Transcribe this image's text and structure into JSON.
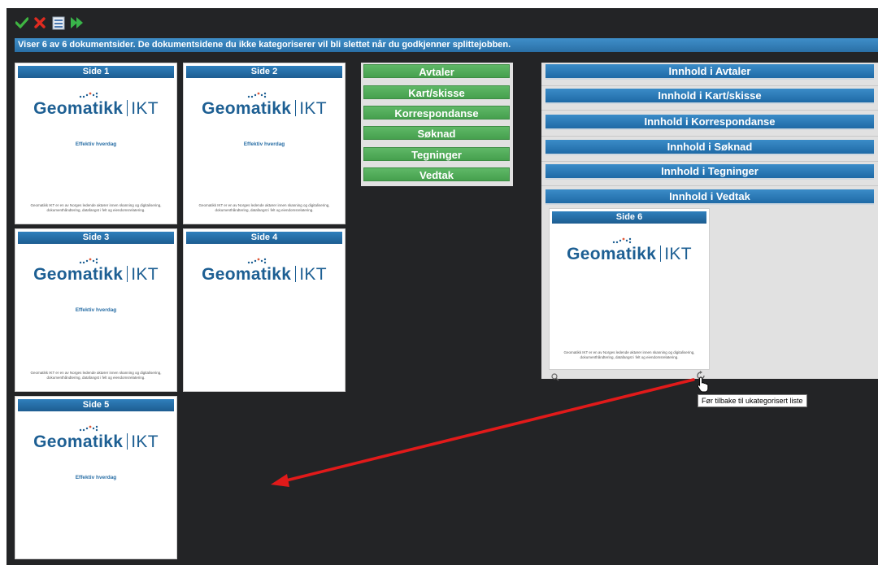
{
  "toolbar": {
    "approve_icon": "check-icon",
    "reject_icon": "close-icon",
    "list_icon": "document-list-icon",
    "next_icon": "forward-icon"
  },
  "info_message": "Viser 6 av 6 dokumentsider. De dokumentsidene du ikke kategoriserer vil bli slettet når du godkjenner splittejobben.",
  "uncategorized_pages": [
    {
      "title": "Side 1",
      "logo": "Geomatikk",
      "logo_suffix": "IKT",
      "tagline": "Effektiv hverdag",
      "footer": "Geomatikk IKT er en av Norges ledende aktører innen skanning og digitalisering, dokumenthåndtering, datafangst i felt og eiendomsrelatering."
    },
    {
      "title": "Side 2",
      "logo": "Geomatikk",
      "logo_suffix": "IKT",
      "tagline": "Effektiv hverdag",
      "footer": "Geomatikk IKT er en av Norges ledende aktører innen skanning og digitalisering, dokumenthåndtering, datafangst i felt og eiendomsrelatering."
    },
    {
      "title": "Side 3",
      "logo": "Geomatikk",
      "logo_suffix": "IKT",
      "tagline": "Effektiv hverdag",
      "footer": "Geomatikk IKT er en av Norges ledende aktører innen skanning og digitalisering, dokumenthåndtering, datafangst i felt og eiendomsrelatering."
    },
    {
      "title": "Side 4",
      "logo": "Geomatikk",
      "logo_suffix": "IKT",
      "tagline": "",
      "footer": ""
    },
    {
      "title": "Side 5",
      "logo": "Geomatikk",
      "logo_suffix": "IKT",
      "tagline": "Effektiv hverdag",
      "footer": ""
    }
  ],
  "categories": [
    "Avtaler",
    "Kart/skisse",
    "Korrespondanse",
    "Søknad",
    "Tegninger",
    "Vedtak"
  ],
  "content_headers": [
    "Innhold i Avtaler",
    "Innhold i Kart/skisse",
    "Innhold i Korrespondanse",
    "Innhold i Søknad",
    "Innhold i Tegninger",
    "Innhold i Vedtak"
  ],
  "categorized_page": {
    "title": "Side 6",
    "logo": "Geomatikk",
    "logo_suffix": "IKT",
    "footer": "Geomatikk IKT er en av Norges ledende aktører innen skanning og digitalisering, dokumenthåndtering, datafangst i felt og eiendomsrelatering."
  },
  "tooltip": "Før tilbake til ukategorisert liste",
  "colors": {
    "accent_blue": "#1f6aa6",
    "category_green": "#4fa957",
    "arrow_red": "#e11a1a"
  }
}
